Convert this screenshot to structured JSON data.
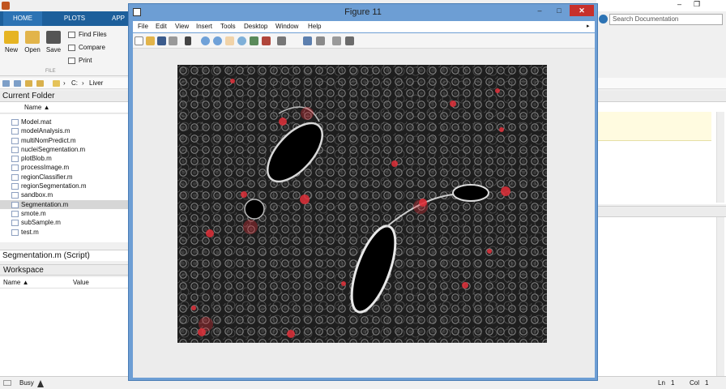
{
  "main": {
    "tabs": [
      {
        "label": "HOME"
      },
      {
        "label": "PLOTS"
      },
      {
        "label": "APP"
      }
    ],
    "ribbon": {
      "new_label": "New",
      "open_label": "Open",
      "save_label": "Save",
      "find_files_label": "Find Files",
      "compare_label": "Compare",
      "print_label": "Print",
      "section_label": "FILE"
    },
    "path": {
      "drive": "C:",
      "sep": "›",
      "folder": "Liver"
    },
    "search_placeholder": "Search Documentation",
    "window_btns": {
      "minimize": "–",
      "maximize": "❐"
    }
  },
  "current_folder": {
    "title": "Current Folder",
    "column": "Name ▲",
    "files": [
      {
        "name": "Model.mat",
        "selected": false
      },
      {
        "name": "modelAnalysis.m",
        "selected": false
      },
      {
        "name": "multiNomPredict.m",
        "selected": false
      },
      {
        "name": "nucleiSegmentation.m",
        "selected": false
      },
      {
        "name": "plotBlob.m",
        "selected": false
      },
      {
        "name": "processImage.m",
        "selected": false
      },
      {
        "name": "regionClassifier.m",
        "selected": false
      },
      {
        "name": "regionSegmentation.m",
        "selected": false
      },
      {
        "name": "sandbox.m",
        "selected": false
      },
      {
        "name": "Segmentation.m",
        "selected": true
      },
      {
        "name": "smote.m",
        "selected": false
      },
      {
        "name": "subSample.m",
        "selected": false
      },
      {
        "name": "test.m",
        "selected": false
      }
    ],
    "details": "Segmentation.m  (Script)"
  },
  "workspace": {
    "title": "Workspace",
    "col_name": "Name ▲",
    "col_value": "Value"
  },
  "status": {
    "busy": "Busy",
    "ln_label": "Ln",
    "ln_value": "1",
    "col_label": "Col",
    "col_value": "1"
  },
  "figure": {
    "title": "Figure 11",
    "menu": [
      "File",
      "Edit",
      "View",
      "Insert",
      "Tools",
      "Desktop",
      "Window",
      "Help"
    ],
    "close_glyph": "✕",
    "min_glyph": "–",
    "max_glyph": "□"
  },
  "colors": {
    "figure_frame": "#6d9ed4",
    "ribbon_tab": "#1d5f9b",
    "close_red": "#c7302b",
    "cell_red": "#e0303a"
  }
}
